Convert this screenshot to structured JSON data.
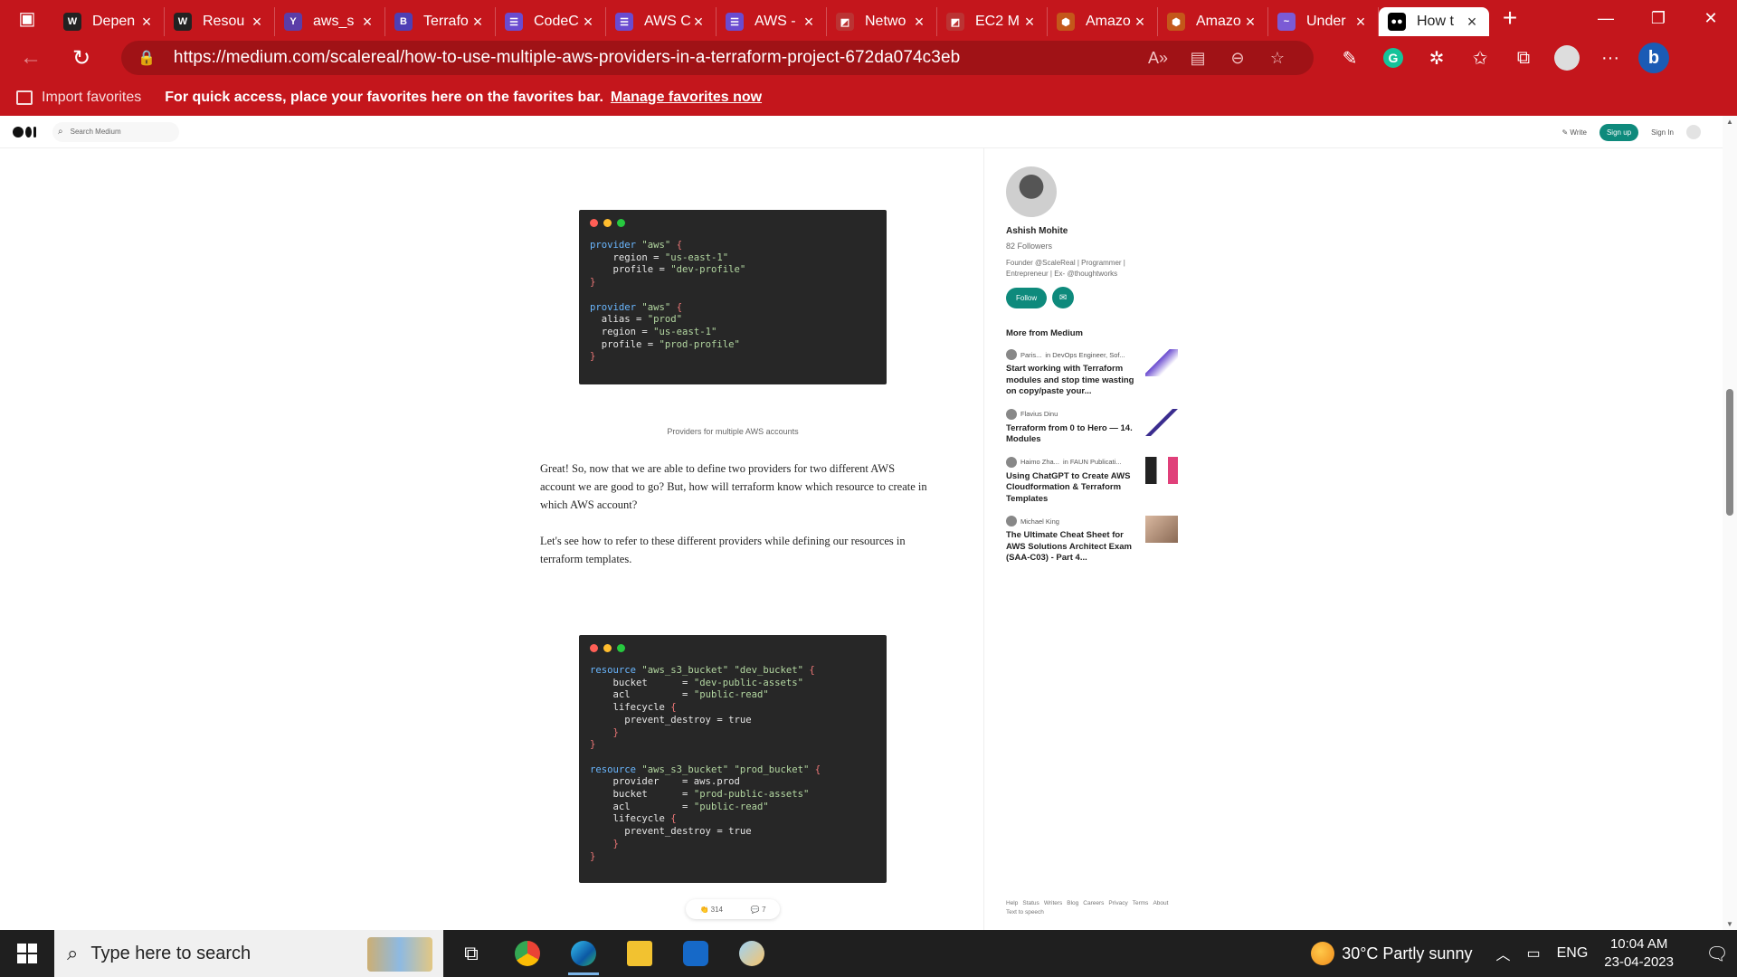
{
  "browser": {
    "tabs": [
      {
        "title": "Depen",
        "fav_color": "#222",
        "fav_text": "W"
      },
      {
        "title": "Resou",
        "fav_color": "#222",
        "fav_text": "W"
      },
      {
        "title": "aws_s",
        "fav_color": "#5b3da8",
        "fav_text": "Y"
      },
      {
        "title": "Terrafo",
        "fav_color": "#4e3fb4",
        "fav_text": "B"
      },
      {
        "title": "CodeC",
        "fav_color": "#6a4bd0",
        "fav_text": "☰"
      },
      {
        "title": "AWS C",
        "fav_color": "#6a4bd0",
        "fav_text": "☰"
      },
      {
        "title": "AWS -",
        "fav_color": "#6a4bd0",
        "fav_text": "☰"
      },
      {
        "title": "Netwo",
        "fav_color": "#b33",
        "fav_text": "◩"
      },
      {
        "title": "EC2 M",
        "fav_color": "#b33",
        "fav_text": "◩"
      },
      {
        "title": "Amazo",
        "fav_color": "#c4571a",
        "fav_text": "⬢"
      },
      {
        "title": "Amazo",
        "fav_color": "#c4571a",
        "fav_text": "⬢"
      },
      {
        "title": "Under",
        "fav_color": "#7b5bd5",
        "fav_text": "~"
      },
      {
        "title": "How t",
        "fav_color": "#000",
        "fav_text": "●●",
        "active": true
      }
    ],
    "url": "https://medium.com/scalereal/how-to-use-multiple-aws-providers-in-a-terraform-project-672da074c3eb",
    "favbar": {
      "import_label": "Import favorites",
      "message": "For quick access, place your favorites here on the favorites bar.",
      "link": "Manage favorites now"
    }
  },
  "medium": {
    "search_placeholder": "Search Medium",
    "write": "Write",
    "signup": "Sign up",
    "signin": "Sign In"
  },
  "article": {
    "code1": [
      [
        {
          "t": "provider ",
          "c": "kw"
        },
        {
          "t": "\"aws\" ",
          "c": "st"
        },
        {
          "t": "{",
          "c": "br"
        }
      ],
      [
        {
          "t": "    region = ",
          "c": ""
        },
        {
          "t": "\"us-east-1\"",
          "c": "st"
        }
      ],
      [
        {
          "t": "    profile = ",
          "c": ""
        },
        {
          "t": "\"dev-profile\"",
          "c": "st"
        }
      ],
      [
        {
          "t": "}",
          "c": "br"
        }
      ],
      [
        {
          "t": "",
          "c": ""
        }
      ],
      [
        {
          "t": "provider ",
          "c": "kw"
        },
        {
          "t": "\"aws\" ",
          "c": "st"
        },
        {
          "t": "{",
          "c": "br"
        }
      ],
      [
        {
          "t": "  alias = ",
          "c": ""
        },
        {
          "t": "\"prod\"",
          "c": "st"
        }
      ],
      [
        {
          "t": "  region = ",
          "c": ""
        },
        {
          "t": "\"us-east-1\"",
          "c": "st"
        }
      ],
      [
        {
          "t": "  profile = ",
          "c": ""
        },
        {
          "t": "\"prod-profile\"",
          "c": "st"
        }
      ],
      [
        {
          "t": "}",
          "c": "br"
        }
      ]
    ],
    "caption1": "Providers for multiple AWS accounts",
    "para1": "Great! So, now that we are able to define two providers for two different AWS account we are good to go? But, how will terraform know which resource to create in which AWS account?",
    "para2": "Let's see how to refer to these different providers while defining our resources in terraform templates.",
    "code2": [
      [
        {
          "t": "resource ",
          "c": "kw"
        },
        {
          "t": "\"aws_s3_bucket\" \"dev_bucket\" ",
          "c": "st"
        },
        {
          "t": "{",
          "c": "br"
        }
      ],
      [
        {
          "t": "    bucket      = ",
          "c": ""
        },
        {
          "t": "\"dev-public-assets\"",
          "c": "st"
        }
      ],
      [
        {
          "t": "    acl         = ",
          "c": ""
        },
        {
          "t": "\"public-read\"",
          "c": "st"
        }
      ],
      [
        {
          "t": "    lifecycle ",
          "c": ""
        },
        {
          "t": "{",
          "c": "br"
        }
      ],
      [
        {
          "t": "      prevent_destroy = true",
          "c": ""
        }
      ],
      [
        {
          "t": "    }",
          "c": "br"
        }
      ],
      [
        {
          "t": "}",
          "c": "br"
        }
      ],
      [
        {
          "t": "",
          "c": ""
        }
      ],
      [
        {
          "t": "resource ",
          "c": "kw"
        },
        {
          "t": "\"aws_s3_bucket\" \"prod_bucket\" ",
          "c": "st"
        },
        {
          "t": "{",
          "c": "br"
        }
      ],
      [
        {
          "t": "    provider    = aws.prod",
          "c": ""
        }
      ],
      [
        {
          "t": "    bucket      = ",
          "c": ""
        },
        {
          "t": "\"prod-public-assets\"",
          "c": "st"
        }
      ],
      [
        {
          "t": "    acl         = ",
          "c": ""
        },
        {
          "t": "\"public-read\"",
          "c": "st"
        }
      ],
      [
        {
          "t": "    lifecycle ",
          "c": ""
        },
        {
          "t": "{",
          "c": "br"
        }
      ],
      [
        {
          "t": "      prevent_destroy = true",
          "c": ""
        }
      ],
      [
        {
          "t": "    }",
          "c": "br"
        }
      ],
      [
        {
          "t": "}",
          "c": "br"
        }
      ]
    ],
    "claps": "314",
    "responses": "7"
  },
  "sidebar": {
    "author_name": "Ashish Mohite",
    "followers": "82 Followers",
    "bio": "Founder @ScaleReal | Programmer | Entrepreneur | Ex- @thoughtworks",
    "follow": "Follow",
    "more_from": "More from Medium",
    "stories": [
      {
        "author": "Paris...",
        "pub": "in  DevOps Engineer, Sof...",
        "title": "Start working with Terraform modules and stop time wasting on copy/paste your..."
      },
      {
        "author": "Flavius Dinu",
        "pub": "",
        "title": "Terraform from 0 to Hero — 14. Modules"
      },
      {
        "author": "Haimo Zha...",
        "pub": "in  FAUN Publicati...",
        "title": "Using ChatGPT to Create AWS Cloudformation & Terraform Templates"
      },
      {
        "author": "Michael King",
        "pub": "",
        "title": "The Ultimate Cheat Sheet for AWS Solutions Architect Exam (SAA-C03) - Part 4..."
      }
    ],
    "footer": [
      "Help",
      "Status",
      "Writers",
      "Blog",
      "Careers",
      "Privacy",
      "Terms",
      "About",
      "Text to speech"
    ]
  },
  "taskbar": {
    "search_placeholder": "Type here to search",
    "weather": "30°C  Partly sunny",
    "lang": "ENG",
    "time": "10:04 AM",
    "date": "23-04-2023"
  }
}
